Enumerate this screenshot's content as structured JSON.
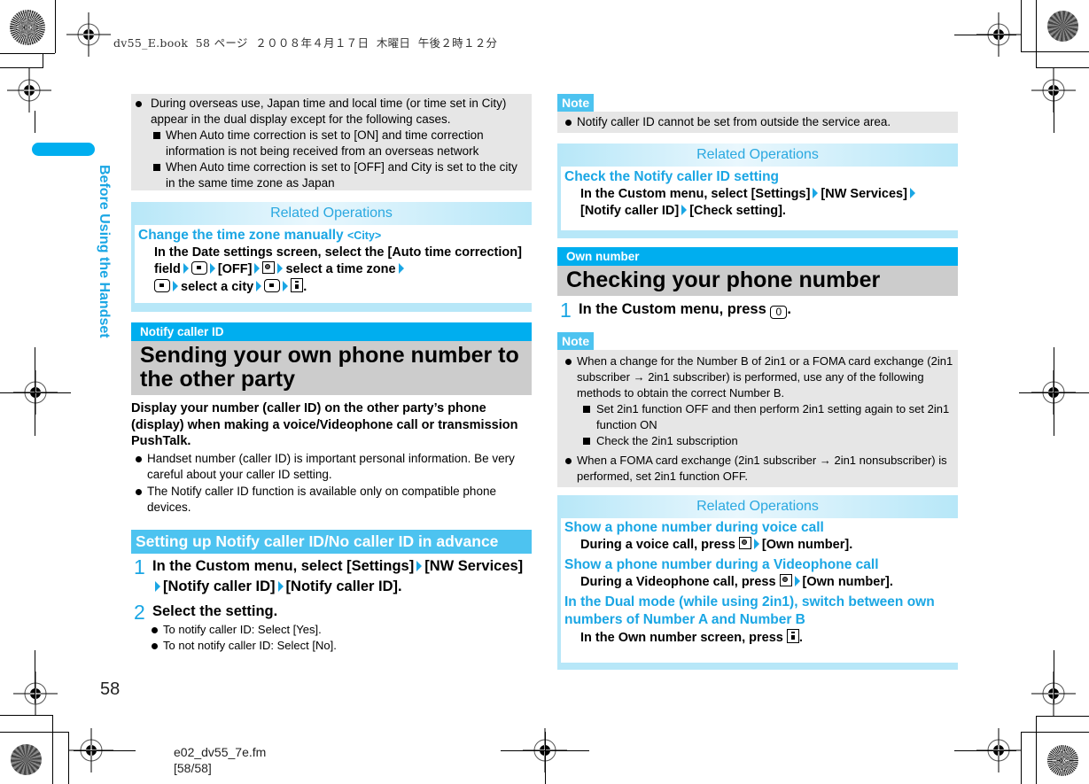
{
  "header_meta": "dv55_E.book  58 ページ  ２００８年４月１７日  木曜日  午後２時１２分",
  "side_title": "Before Using the Handset",
  "page_number": "58",
  "footer": {
    "file": "e02_dv55_7e.fm",
    "pages": "[58/58]"
  },
  "left": {
    "overseas_note": {
      "bullet": "During overseas use, Japan time and local time (or time set in City) appear in the dual display except for the following cases.",
      "subitems": [
        "When Auto time correction is set to [ON] and time correction information is not being received from an overseas network",
        "When Auto time correction is set to [OFF] and City is set to the city in the same time zone as Japan"
      ]
    },
    "related1": {
      "heading": "Related Operations",
      "title": "Change the time zone manually",
      "title_tag": "<City>",
      "desc_parts": [
        "In the Date settings screen, select the [Auto time correction] field",
        "[OFF]",
        "select a time zone",
        "select a city"
      ]
    },
    "section": {
      "category": "Notify caller ID",
      "title": "Sending your own phone number to the other party",
      "intro": "Display your number (caller ID) on the other party’s phone (display) when making a voice/Videophone call or transmission PushTalk.",
      "bullets": [
        "Handset number (caller ID) is important personal information. Be very careful about your caller ID setting.",
        "The Notify caller ID function is available only on compatible phone devices."
      ]
    },
    "subsection": {
      "title": "Setting up Notify caller ID/No caller ID in advance",
      "steps": [
        {
          "num": "1",
          "parts": [
            "In the Custom menu, select [Settings]",
            "[NW Services]",
            "[Notify caller ID]",
            "[Notify caller ID]."
          ]
        },
        {
          "num": "2",
          "text": "Select the setting."
        }
      ],
      "step2_bullets": [
        "To notify caller ID: Select [Yes].",
        "To not notify caller ID: Select [No]."
      ]
    }
  },
  "right": {
    "note1": {
      "tag": "Note",
      "bullet": "Notify caller ID cannot be set from outside the service area."
    },
    "related2": {
      "heading": "Related Operations",
      "title": "Check the Notify caller ID setting",
      "parts": [
        "In the Custom menu, select [Settings]",
        "[NW Services]",
        "[Notify caller ID]",
        "[Check setting]."
      ]
    },
    "section": {
      "category": "Own number",
      "title": "Checking your phone number",
      "step": {
        "num": "1",
        "text": "In the Custom menu, press",
        "key": "0"
      }
    },
    "note2": {
      "tag": "Note",
      "bullet1": "When a change for the Number B of 2in1 or a FOMA card exchange (2in1 subscriber → 2in1 subscriber) is performed, use any of the following methods to obtain the correct Number B.",
      "subitems": [
        "Set 2in1 function OFF and then perform 2in1 setting again to set 2in1 function ON",
        "Check the 2in1 subscription"
      ],
      "bullet2": "When a FOMA card exchange (2in1 subscriber → 2in1 nonsubscriber) is performed, set 2in1 function OFF."
    },
    "related3": {
      "heading": "Related Operations",
      "items": [
        {
          "title": "Show a phone number during voice call",
          "desc": "During a voice call, press",
          "after": "[Own number]."
        },
        {
          "title": "Show a phone number during a Videophone call",
          "desc": "During a Videophone call, press",
          "after": "[Own number]."
        },
        {
          "title": "In the Dual mode (while using 2in1), switch between own numbers of Number A and Number B",
          "desc": "In the Own number screen, press"
        }
      ]
    }
  }
}
